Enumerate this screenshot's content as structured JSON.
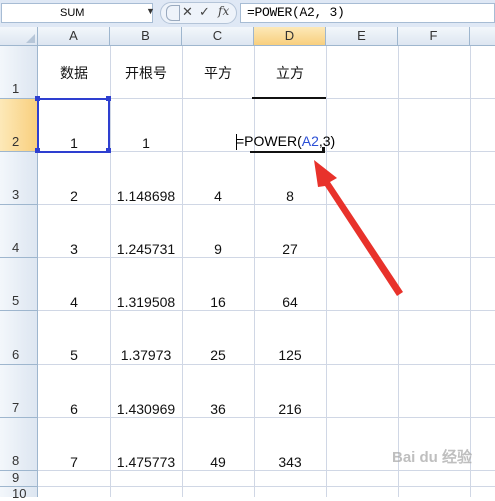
{
  "formula_bar": {
    "name_box": "SUM",
    "cancel_symbol": "✕",
    "enter_symbol": "✓",
    "function_symbol": "fx",
    "formula": "=POWER(A2, 3)"
  },
  "columns": [
    "A",
    "B",
    "C",
    "D",
    "E",
    "F"
  ],
  "rows": [
    "1",
    "2",
    "3",
    "4",
    "5",
    "6",
    "7",
    "8",
    "9",
    "10"
  ],
  "headers": {
    "a": "数据",
    "b": "开根号",
    "c": "平方",
    "d": "立方"
  },
  "data_rows": [
    {
      "a": "1",
      "b": "1",
      "c": "",
      "d": ""
    },
    {
      "a": "2",
      "b": "1.148698",
      "c": "4",
      "d": "8"
    },
    {
      "a": "3",
      "b": "1.245731",
      "c": "9",
      "d": "27"
    },
    {
      "a": "4",
      "b": "1.319508",
      "c": "16",
      "d": "64"
    },
    {
      "a": "5",
      "b": "1.37973",
      "c": "25",
      "d": "125"
    },
    {
      "a": "6",
      "b": "1.430969",
      "c": "36",
      "d": "216"
    },
    {
      "a": "7",
      "b": "1.475773",
      "c": "49",
      "d": "343"
    }
  ],
  "editing_cell": {
    "prefix": "=POWER(",
    "ref": "A2",
    "suffix": ",3)"
  },
  "watermark": "Bai du 经验",
  "colors": {
    "selection": "#2e3fd0",
    "reference": "#2b4fd6",
    "arrow": "#e8322b",
    "header_selected": "#f8cf7e"
  }
}
